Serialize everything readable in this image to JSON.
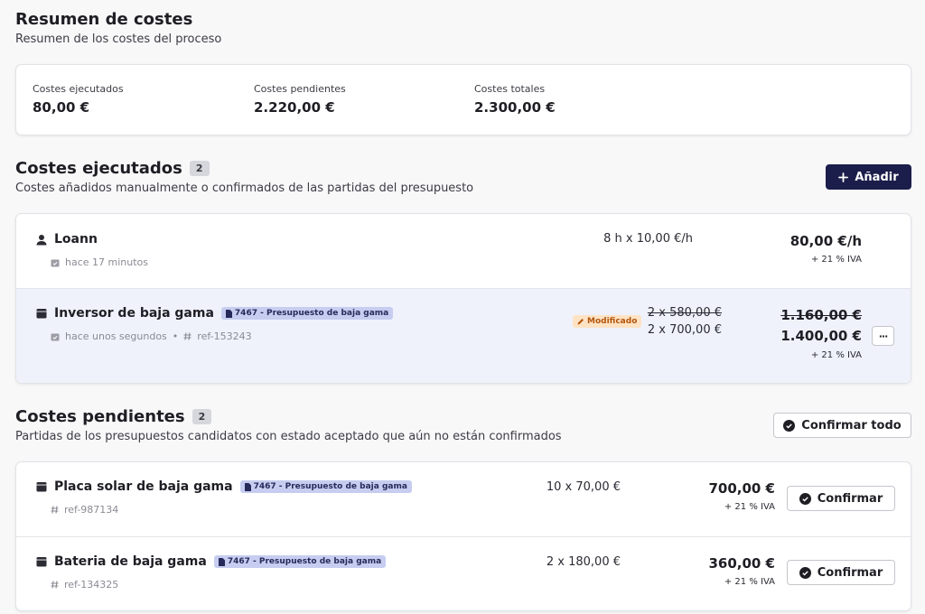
{
  "summary": {
    "title": "Resumen de costes",
    "subtitle": "Resumen de los costes del proceso",
    "metrics": [
      {
        "label": "Costes ejecutados",
        "value": "80,00 €"
      },
      {
        "label": "Costes pendientes",
        "value": "2.220,00 €"
      },
      {
        "label": "Costes totales",
        "value": "2.300,00 €"
      }
    ]
  },
  "executed": {
    "title": "Costes ejecutados",
    "count": "2",
    "subtitle": "Costes añadidos manualmente o confirmados de las partidas del presupuesto",
    "add_label": "Añadir",
    "rows": [
      {
        "name": "Loann",
        "time": "hace 17 minutos",
        "qty": "8 h x 10,00 €/h",
        "amount": "80,00 €/h",
        "iva": "+ 21 % IVA"
      },
      {
        "name": "Inversor de baja gama",
        "tag": "7467 - Presupuesto de baja gama",
        "time": "hace unos segundos",
        "sep": "•",
        "ref": "ref-153243",
        "modified": "Modificado",
        "qty_old": "2 x 580,00 €",
        "qty": "2 x 700,00 €",
        "amount_old": "1.160,00 €",
        "amount": "1.400,00 €",
        "iva": "+ 21 % IVA",
        "more": "···"
      }
    ]
  },
  "pending": {
    "title": "Costes pendientes",
    "count": "2",
    "subtitle": "Partidas de los presupuestos candidatos con estado aceptado que aún no están confirmados",
    "confirm_all_label": "Confirmar todo",
    "rows": [
      {
        "name": "Placa solar de baja gama",
        "tag": "7467 - Presupuesto de baja gama",
        "ref": "ref-987134",
        "qty": "10 x 70,00 €",
        "amount": "700,00 €",
        "iva": "+ 21 % IVA",
        "confirm_label": "Confirmar"
      },
      {
        "name": "Bateria de baja gama",
        "tag": "7467 - Presupuesto de baja gama",
        "ref": "ref-134325",
        "qty": "2 x 180,00 €",
        "amount": "360,00 €",
        "iva": "+ 21 % IVA",
        "confirm_label": "Confirmar"
      }
    ]
  }
}
